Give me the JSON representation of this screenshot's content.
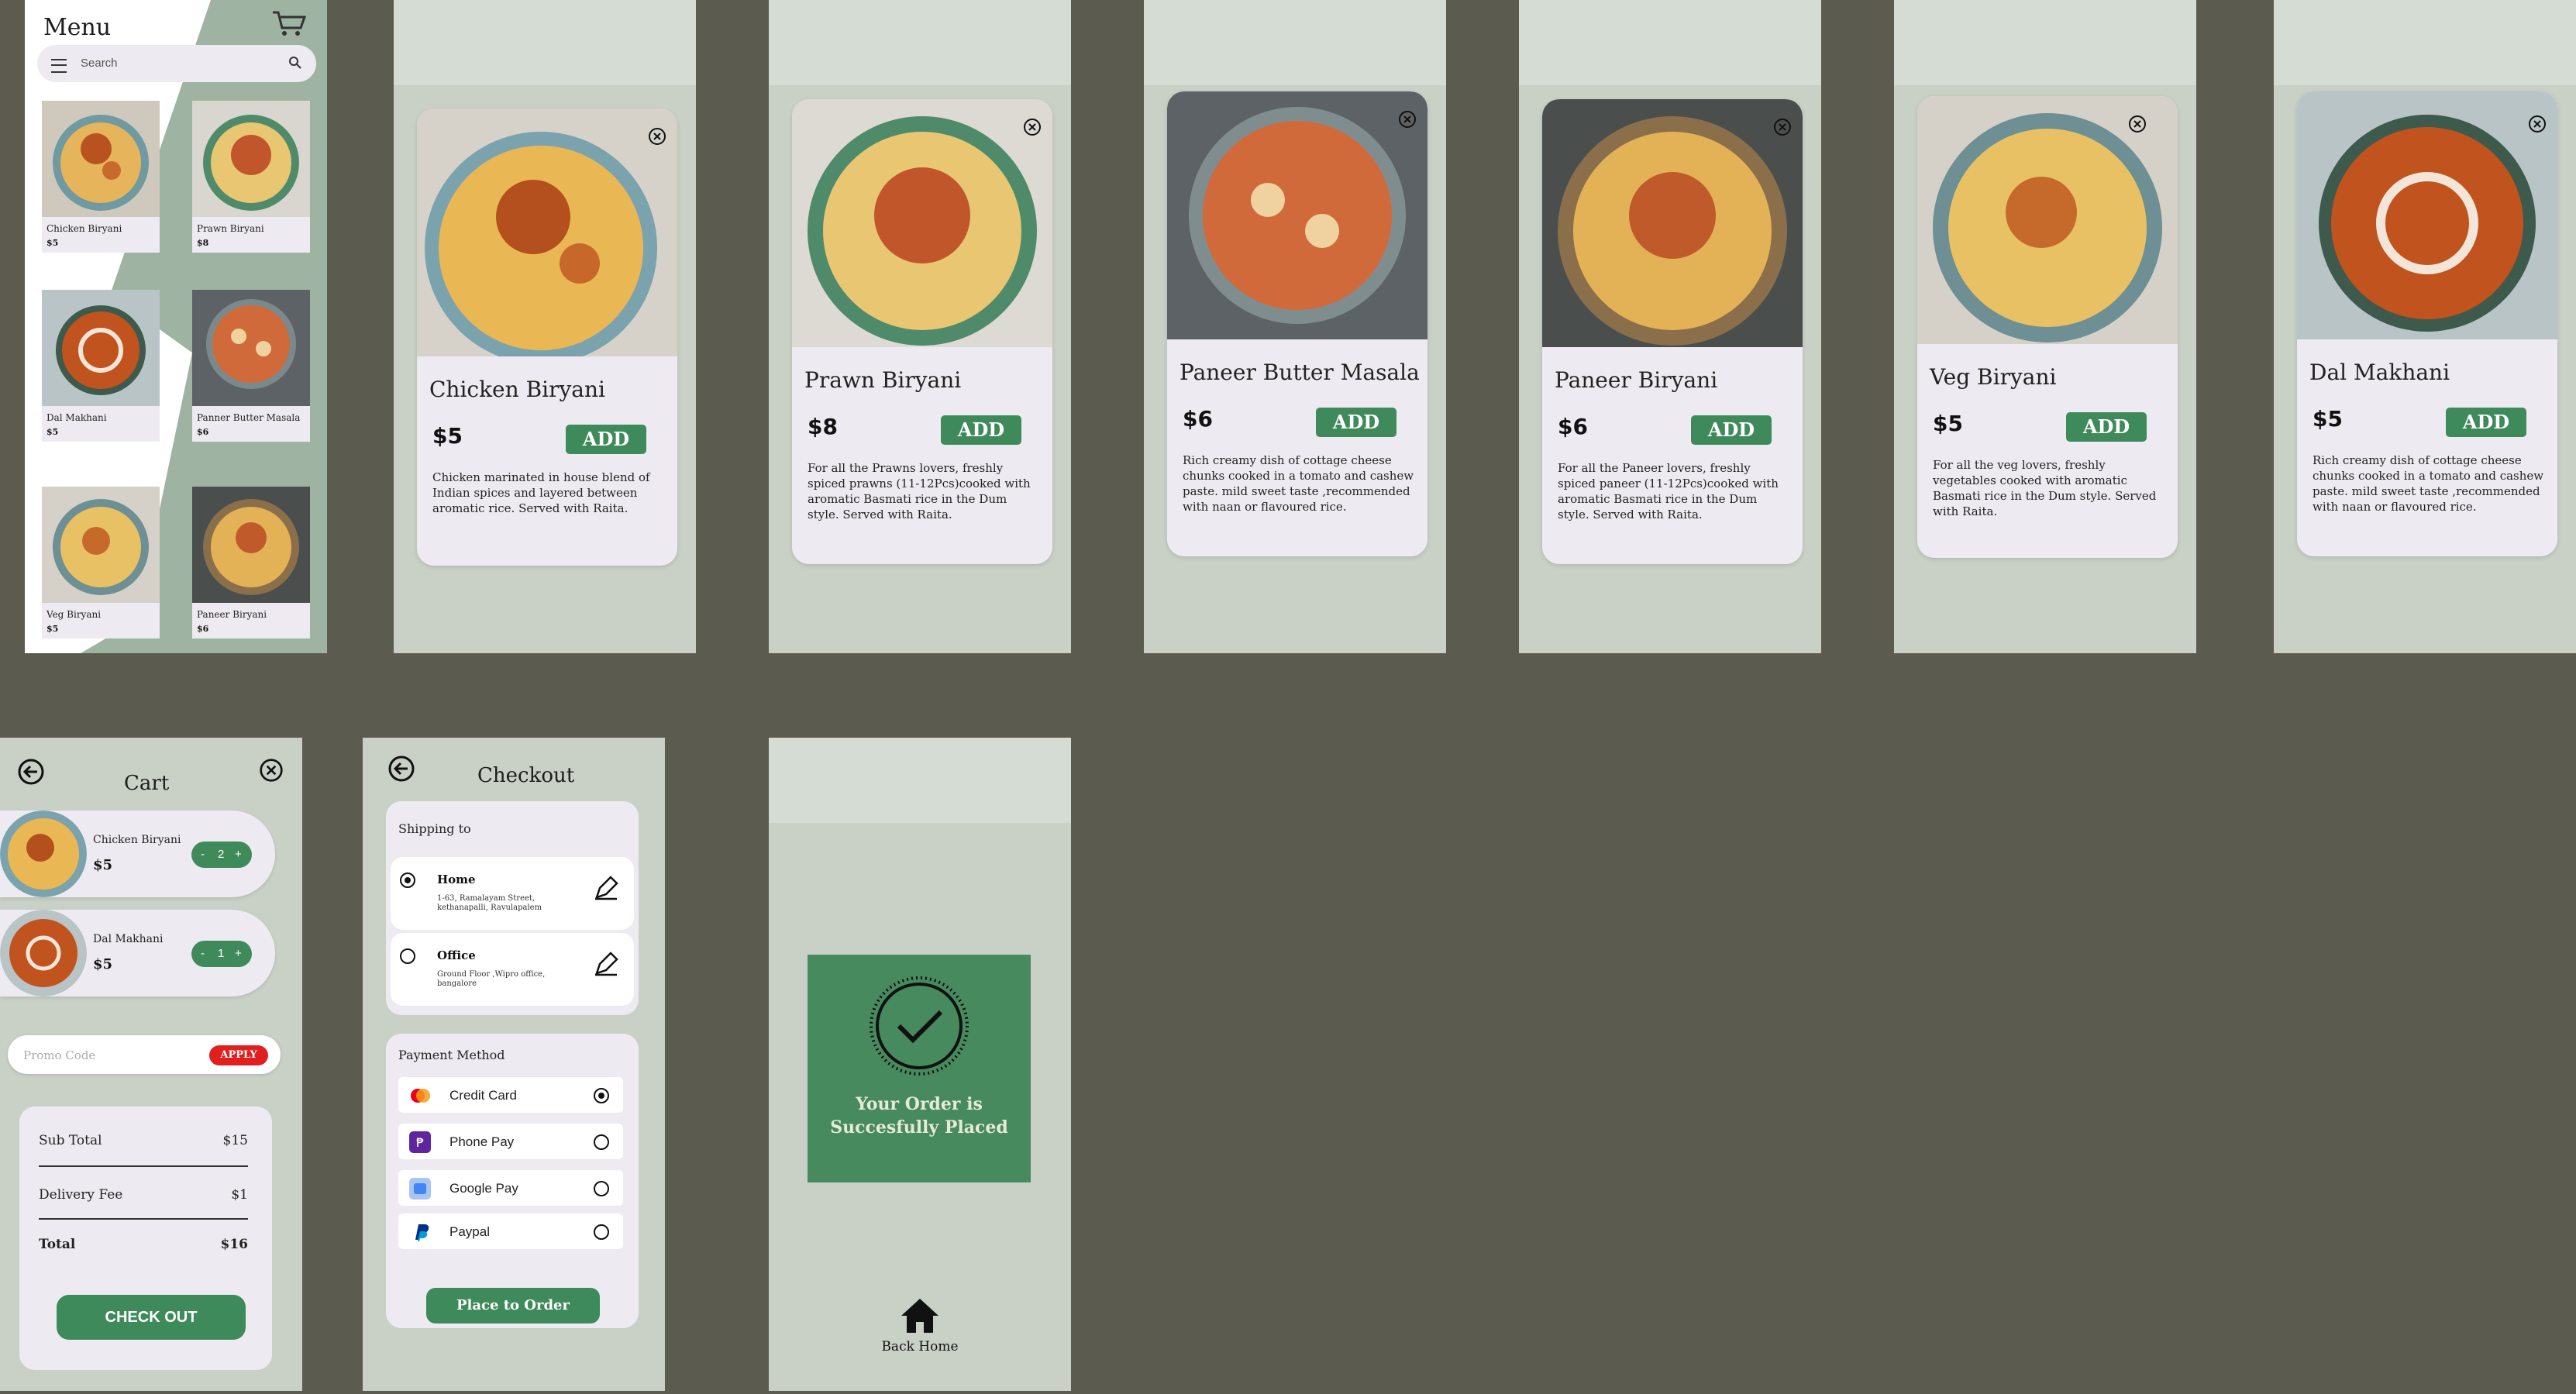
{
  "menu": {
    "title": "Menu",
    "search_placeholder": "Search",
    "items": [
      {
        "name": "Chicken Biryani",
        "price": "$5"
      },
      {
        "name": "Prawn Biryani",
        "price": "$8"
      },
      {
        "name": "Dal Makhani",
        "price": "$5"
      },
      {
        "name": "Panner Butter Masala",
        "price": "$6"
      },
      {
        "name": "Veg Biryani",
        "price": "$5"
      },
      {
        "name": "Paneer Biryani",
        "price": "$6"
      }
    ]
  },
  "details": [
    {
      "name": "Chicken Biryani",
      "price": "$5",
      "add": "ADD",
      "desc": "Chicken marinated in house blend of Indian spices and layered between aromatic rice. Served with Raita."
    },
    {
      "name": "Prawn Biryani",
      "price": "$8",
      "add": "ADD",
      "desc": "For all the Prawns lovers, freshly spiced prawns (11-12Pcs)cooked with aromatic Basmati rice in the Dum style. Served with Raita."
    },
    {
      "name": "Paneer Butter Masala",
      "price": "$6",
      "add": "ADD",
      "desc": "Rich creamy dish of cottage cheese chunks cooked in a tomato and cashew paste. mild sweet taste ,recommended with naan or flavoured rice."
    },
    {
      "name": "Paneer Biryani",
      "price": "$6",
      "add": "ADD",
      "desc": "For all the Paneer lovers, freshly spiced paneer (11-12Pcs)cooked with aromatic Basmati rice in the Dum style. Served with Raita."
    },
    {
      "name": "Veg Biryani",
      "price": "$5",
      "add": "ADD",
      "desc": "For all the veg lovers, freshly vegetables cooked with aromatic Basmati rice in the Dum style. Served with Raita."
    },
    {
      "name": "Dal Makhani",
      "price": "$5",
      "add": "ADD",
      "desc": "Rich creamy dish of cottage cheese chunks cooked in a tomato and cashew paste. mild sweet taste ,recommended with naan or flavoured rice."
    }
  ],
  "cart": {
    "title": "Cart",
    "items": [
      {
        "name": "Chicken Biryani",
        "price": "$5",
        "qty": "2"
      },
      {
        "name": "Dal Makhani",
        "price": "$5",
        "qty": "1"
      }
    ],
    "promo_placeholder": "Promo Code",
    "apply": "APPLY",
    "subtotal_label": "Sub Total",
    "subtotal": "$15",
    "delivery_label": "Delivery Fee",
    "delivery": "$1",
    "total_label": "Total",
    "total": "$16",
    "checkout": "CHECK OUT"
  },
  "checkout": {
    "title": "Checkout",
    "shipping_label": "Shipping to",
    "addresses": [
      {
        "name": "Home",
        "line": "1-63, Ramalayam Street, kethanapalli, Ravulapalem"
      },
      {
        "name": "Office",
        "line": "Ground Floor ,Wipro office, bangalore"
      }
    ],
    "payment_label": "Payment Method",
    "methods": [
      "Credit Card",
      "Phone Pay",
      "Google Pay",
      "Paypal"
    ],
    "place": "Place to Order"
  },
  "success": {
    "message": "Your Order is Succesfully Placed",
    "back_home": "Back Home"
  },
  "colors": {
    "accent": "#3f8a5a",
    "bg": "#5c5b4f",
    "sage": "#9fb3a2",
    "card": "#eeeaf1",
    "apply": "#e02020"
  }
}
